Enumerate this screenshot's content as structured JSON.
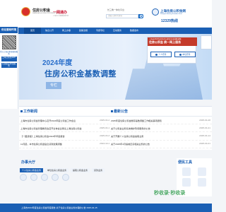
{
  "header": {
    "left_logo_title": "住房公积金",
    "left_logo_sub": "SHANGHAI HOUSING PROVIDENT FUND",
    "yiwang": "一网通办",
    "yiwang_sub": "上海市公共数据资源开放",
    "site_links": "长三角一体化平台",
    "search_placeholder": "请输入搜索关键词",
    "right_logo": "上海住房公积金网",
    "right_logo_sub": "Shanghai Housing Provident Fund",
    "hotline": "12329热线"
  },
  "nav": [
    "首页",
    "信息公开",
    "网上办事",
    "政策法规",
    "专题专栏",
    "互动服务",
    "数据发布"
  ],
  "side": {
    "head": "优化营商环境",
    "qr_label": "关注上海公积金微信服务",
    "block1": "上海公积金APP",
    "block2": "行政事业单位服务"
  },
  "banner": {
    "year": "2024年度",
    "title": "住房公积金基数调整",
    "tag": "专栏"
  },
  "login": {
    "notice_small": "上海市2024年度住房公积金年度基数调整",
    "notice_big": "住房公积金 统一网上服务",
    "personal": "个人登录",
    "unit": "单位登录"
  },
  "news": {
    "title": "工作新闻",
    "items": [
      {
        "title": "上海市住房公积金管理中心召开2024年度公积金工作会议",
        "date": "2025-04-24"
      },
      {
        "title": "上海市住房公积金管理委员会召开全体会议审议上海住房公积金",
        "date": "2025-04-14"
      },
      {
        "title": "【一图读懂】上海住房公积金2024年年度报告",
        "date": "2025-03-31"
      },
      {
        "title": "11月起，本市住房公积金贴息贷款政策调整",
        "date": "2024-10-17"
      }
    ]
  },
  "announce": {
    "title": "最新公告",
    "items": [
      {
        "title": "2025年度住房公积金缴存基数调整工作相关事项通知",
        "date": "2025-04-28"
      },
      {
        "title": "关于公积金业务系统维护暂停服务的公告",
        "date": "2025-04-21"
      },
      {
        "title": "关于开展个人住房公积金提取业务",
        "date": "2025-04-14"
      },
      {
        "title": "关于2025年4月提前还贷相关业务的公告",
        "date": "2025-04-01"
      }
    ]
  },
  "service": {
    "title": "办事大厅",
    "tabs": [
      "个人住房公积金业务",
      "单位住房公积金业务",
      "提取公积金业务",
      "贷款业务"
    ]
  },
  "convenience": {
    "title": "便民工具"
  },
  "ticker": "上海市2024年度住房公积金年度报告  关于住房公积金业务办理的公告  2025-04-15",
  "watermark": "秒收录·秒收录"
}
